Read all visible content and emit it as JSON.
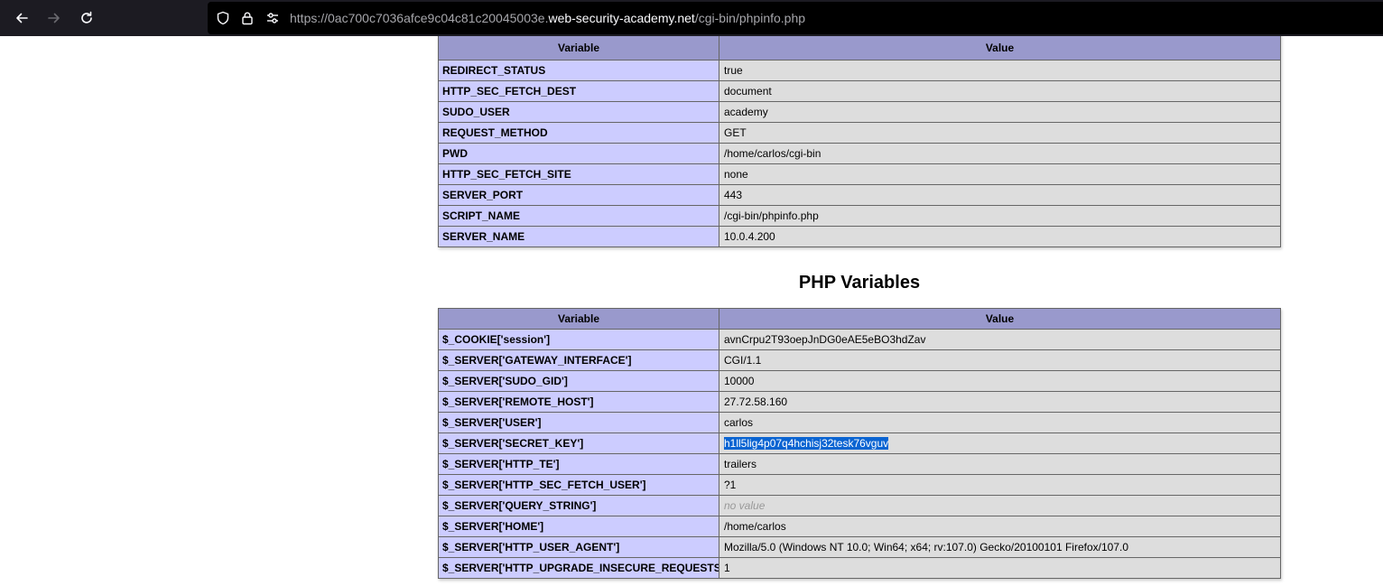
{
  "browser": {
    "url_prefix": "https://0ac700c7036afce9c04c81c20045003e.",
    "url_host": "web-security-academy.net",
    "url_path": "/cgi-bin/phpinfo.php",
    "icons": [
      "back-icon",
      "forward-icon",
      "reload-icon",
      "shield-icon",
      "lock-icon",
      "permissions-icon"
    ]
  },
  "env_table": {
    "col_variable": "Variable",
    "col_value": "Value",
    "rows": [
      {
        "name": "REDIRECT_STATUS",
        "value": "true"
      },
      {
        "name": "HTTP_SEC_FETCH_DEST",
        "value": "document"
      },
      {
        "name": "SUDO_USER",
        "value": "academy"
      },
      {
        "name": "REQUEST_METHOD",
        "value": "GET"
      },
      {
        "name": "PWD",
        "value": "/home/carlos/cgi-bin"
      },
      {
        "name": "HTTP_SEC_FETCH_SITE",
        "value": "none"
      },
      {
        "name": "SERVER_PORT",
        "value": "443"
      },
      {
        "name": "SCRIPT_NAME",
        "value": "/cgi-bin/phpinfo.php"
      },
      {
        "name": "SERVER_NAME",
        "value": "10.0.4.200"
      }
    ]
  },
  "php_section": {
    "title": "PHP Variables",
    "col_variable": "Variable",
    "col_value": "Value",
    "rows": [
      {
        "name": "$_COOKIE['session']",
        "value": "avnCrpu2T93oepJnDG0eAE5eBO3hdZav"
      },
      {
        "name": "$_SERVER['GATEWAY_INTERFACE']",
        "value": "CGI/1.1"
      },
      {
        "name": "$_SERVER['SUDO_GID']",
        "value": "10000"
      },
      {
        "name": "$_SERVER['REMOTE_HOST']",
        "value": "27.72.58.160"
      },
      {
        "name": "$_SERVER['USER']",
        "value": "carlos"
      },
      {
        "name": "$_SERVER['SECRET_KEY']",
        "value": "h1ll5lig4p07q4hchisj32tesk76vguv"
      },
      {
        "name": "$_SERVER['HTTP_TE']",
        "value": "trailers"
      },
      {
        "name": "$_SERVER['HTTP_SEC_FETCH_USER']",
        "value": "?1"
      },
      {
        "name": "$_SERVER['QUERY_STRING']",
        "value": "no value"
      },
      {
        "name": "$_SERVER['HOME']",
        "value": "/home/carlos"
      },
      {
        "name": "$_SERVER['HTTP_USER_AGENT']",
        "value": "Mozilla/5.0 (Windows NT 10.0; Win64; x64; rv:107.0) Gecko/20100101 Firefox/107.0"
      },
      {
        "name": "$_SERVER['HTTP_UPGRADE_INSECURE_REQUESTS']",
        "value": "1"
      }
    ]
  },
  "colors": {
    "header_bg": "#9999cc",
    "name_cell_bg": "#ccccff",
    "value_cell_bg": "#dddddd",
    "selection_bg": "#0a64d2"
  }
}
